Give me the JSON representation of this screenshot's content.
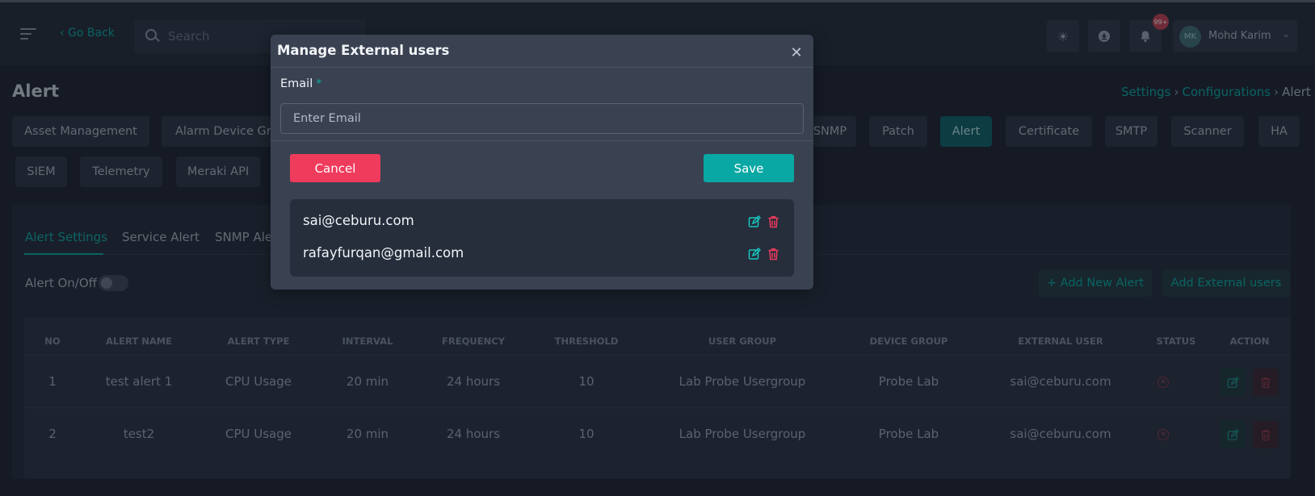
{
  "header": {
    "go_back": "‹ Go Back",
    "search_placeholder": "Search",
    "notification_badge": "99+",
    "user_initials": "MK",
    "user_name": "Mohd Karim"
  },
  "page": {
    "title": "Alert",
    "breadcrumb": [
      "Settings",
      "Configurations",
      "Alert"
    ]
  },
  "config_tabs": [
    {
      "label": "Asset Management"
    },
    {
      "label": "Alarm Device Gro"
    },
    {
      "label": "SNMP"
    },
    {
      "label": "Patch"
    },
    {
      "label": "Alert",
      "active": true
    },
    {
      "label": "Certificate"
    },
    {
      "label": "SMTP"
    },
    {
      "label": "Scanner"
    },
    {
      "label": "HA"
    },
    {
      "label": "SIEM"
    },
    {
      "label": "Telemetry"
    },
    {
      "label": "Meraki API"
    }
  ],
  "sub_tabs": [
    {
      "label": "Alert Settings",
      "active": true
    },
    {
      "label": "Service Alert"
    },
    {
      "label": "SNMP Aler"
    }
  ],
  "toolbar": {
    "toggle_label": "Alert On/Off",
    "add_new_alert": "+ Add New Alert",
    "add_external_users": "Add External users"
  },
  "table": {
    "columns": [
      "NO",
      "ALERT NAME",
      "ALERT TYPE",
      "INTERVAL",
      "FREQUENCY",
      "THRESHOLD",
      "USER GROUP",
      "DEVICE GROUP",
      "EXTERNAL USER",
      "STATUS",
      "ACTION"
    ],
    "rows": [
      [
        "1",
        "test alert 1",
        "CPU Usage",
        "20 min",
        "24 hours",
        "10",
        "Lab Probe Usergroup",
        "Probe Lab",
        "sai@ceburu.com"
      ],
      [
        "2",
        "test2",
        "CPU Usage",
        "20 min",
        "24 hours",
        "10",
        "Lab Probe Usergroup",
        "Probe Lab",
        "sai@ceburu.com"
      ]
    ]
  },
  "modal": {
    "title": "Manage External users",
    "close_icon": "close-icon",
    "email_label": "Email",
    "required_mark": "*",
    "email_placeholder": "Enter Email",
    "cancel_label": "Cancel",
    "save_label": "Save",
    "users": [
      "sai@ceburu.com",
      "rafayfurqan@gmail.com"
    ]
  },
  "colors": {
    "accent": "#0aa6a2",
    "danger": "#ef3b5c",
    "modal_bg": "#3a4252",
    "page_bg": "#1c2230"
  }
}
